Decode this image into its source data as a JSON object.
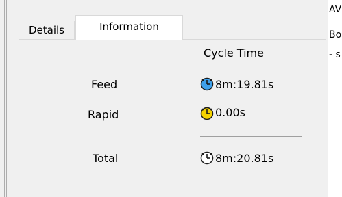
{
  "tabs": [
    {
      "label": "Details"
    },
    {
      "label": "Information"
    }
  ],
  "cycle_time": {
    "header": "Cycle Time",
    "rows": [
      {
        "label": "Feed",
        "value": "8m:19.81s",
        "icon": "clock-blue-icon",
        "color": "#3ea0ea"
      },
      {
        "label": "Rapid",
        "value": "0.00s",
        "icon": "clock-yellow-icon",
        "color": "#f5d300"
      },
      {
        "label": "Total",
        "value": "8m:20.81s",
        "icon": "clock-white-icon",
        "color": "#ffffff"
      }
    ]
  },
  "right_edge_text": [
    "AV",
    "Bo",
    "- s"
  ]
}
